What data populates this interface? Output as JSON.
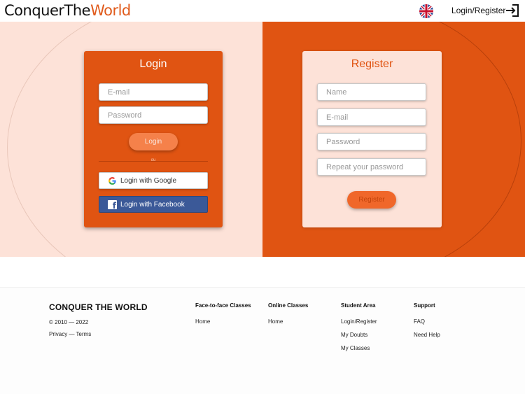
{
  "header": {
    "logo_part1": "Conquer",
    "logo_part2": "The",
    "logo_part3": "World",
    "language_icon": "uk-flag-icon",
    "login_register_label": "Login/Register",
    "login_icon": "sign-in-icon"
  },
  "login": {
    "title": "Login",
    "email_placeholder": "E-mail",
    "password_placeholder": "Password",
    "login_button": "Login",
    "divider_text": "ou",
    "google_button": "Login with Google",
    "facebook_button": "Login with Facebook"
  },
  "register": {
    "title": "Register",
    "name_placeholder": "Name",
    "email_placeholder": "E-mail",
    "password_placeholder": "Password",
    "repeat_password_placeholder": "Repeat your password",
    "register_button": "Register"
  },
  "footer": {
    "brand": "CONQUER THE WORLD",
    "copyright": "© 2010 — 2022",
    "legal": "Privacy — Terms",
    "columns": [
      {
        "title": "Face-to-face Classes",
        "links": [
          "Home"
        ]
      },
      {
        "title": "Online Classes",
        "links": [
          "Home"
        ]
      },
      {
        "title": "Student Area",
        "links": [
          "Login/Register",
          "My Doubts",
          "My Classes"
        ]
      },
      {
        "title": "Support",
        "links": [
          "FAQ",
          "Need Help"
        ]
      }
    ]
  },
  "colors": {
    "brand_orange": "#e05412",
    "light_peach": "#fde2d8",
    "button_orange": "#f5814a",
    "facebook_blue": "#3b5998"
  }
}
